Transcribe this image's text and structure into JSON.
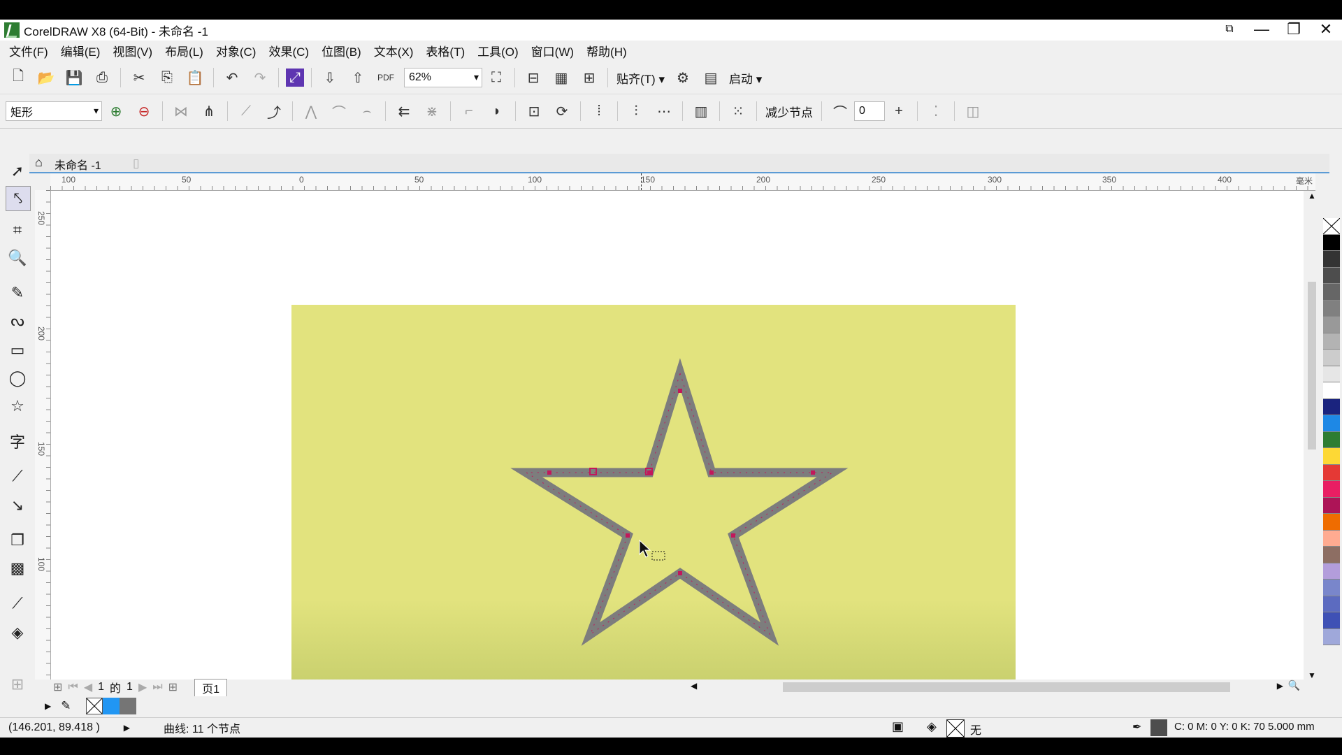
{
  "window": {
    "title": "CorelDRAW X8 (64-Bit) - 未命名 -1",
    "controls": [
      "—",
      "❐",
      "✕"
    ]
  },
  "menu": [
    "文件(F)",
    "编辑(E)",
    "视图(V)",
    "布局(L)",
    "对象(C)",
    "效果(C)",
    "位图(B)",
    "文本(X)",
    "表格(T)",
    "工具(O)",
    "窗口(W)",
    "帮助(H)"
  ],
  "toolbar": {
    "zoom": "62%",
    "snap_label": "贴齐(T)",
    "launch_label": "启动"
  },
  "property_bar": {
    "shape_type": "矩形",
    "reduce_nodes_label": "减少节点",
    "smoothing_value": "0",
    "plus_label": "+"
  },
  "document": {
    "tab_name": "未命名 -1"
  },
  "ruler": {
    "h_ticks": [
      "100",
      "50",
      "0",
      "50",
      "100",
      "150",
      "200",
      "250",
      "300",
      "350",
      "400"
    ],
    "unit": "毫米",
    "v_ticks": [
      "250",
      "200",
      "150",
      "100"
    ]
  },
  "page_nav": {
    "current": "1",
    "of_label": "的",
    "total": "1",
    "page_tab": "页1"
  },
  "palette": [
    "#none",
    "#000000",
    "#333333",
    "#4d4d4d",
    "#666666",
    "#808080",
    "#999999",
    "#b3b3b3",
    "#cccccc",
    "#e6e6e6",
    "#ffffff",
    "#1a237e",
    "#1e88e5",
    "#2e7d32",
    "#fdd835",
    "#e53935",
    "#e91e63",
    "#ad1457",
    "#ef6c00",
    "#ffab91",
    "#8d6e63",
    "#b39ddb",
    "#7986cb",
    "#5c6bc0",
    "#3f51b5",
    "#9fa8da"
  ],
  "status": {
    "coords": "(146.201, 89.418 )",
    "object_info": "曲线: 11 个节点",
    "fill_label": "无",
    "outline_info": "C: 0 M: 0 Y: 0 K: 70  5.000 mm"
  },
  "colors": {
    "background_rect": "#e2e37e",
    "star_outline": "#7d7d7d",
    "node_color": "#c2185b"
  }
}
